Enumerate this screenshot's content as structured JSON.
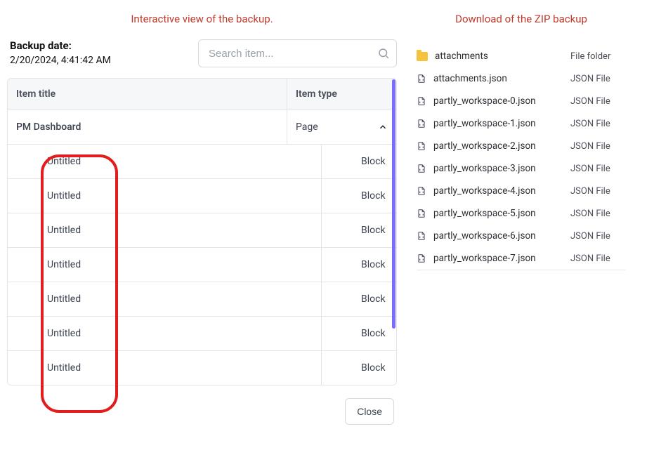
{
  "captions": {
    "left": "Interactive view of the backup.",
    "right": "Download of the ZIP backup"
  },
  "backup": {
    "label": "Backup date:",
    "value": "2/20/2024, 4:41:42 AM"
  },
  "search": {
    "placeholder": "Search item..."
  },
  "table": {
    "header_title": "Item title",
    "header_type": "Item type",
    "page": {
      "title": "PM Dashboard",
      "type": "Page"
    },
    "blocks": [
      {
        "title": "Untitled",
        "type": "Block"
      },
      {
        "title": "Untitled",
        "type": "Block"
      },
      {
        "title": "Untitled",
        "type": "Block"
      },
      {
        "title": "Untitled",
        "type": "Block"
      },
      {
        "title": "Untitled",
        "type": "Block"
      },
      {
        "title": "Untitled",
        "type": "Block"
      },
      {
        "title": "Untitled",
        "type": "Block"
      }
    ]
  },
  "close_label": "Close",
  "files": [
    {
      "name": "attachments",
      "type": "File folder",
      "icon": "folder"
    },
    {
      "name": "attachments.json",
      "type": "JSON File",
      "icon": "json"
    },
    {
      "name": "partly_workspace-0.json",
      "type": "JSON File",
      "icon": "json"
    },
    {
      "name": "partly_workspace-1.json",
      "type": "JSON File",
      "icon": "json"
    },
    {
      "name": "partly_workspace-2.json",
      "type": "JSON File",
      "icon": "json"
    },
    {
      "name": "partly_workspace-3.json",
      "type": "JSON File",
      "icon": "json"
    },
    {
      "name": "partly_workspace-4.json",
      "type": "JSON File",
      "icon": "json"
    },
    {
      "name": "partly_workspace-5.json",
      "type": "JSON File",
      "icon": "json"
    },
    {
      "name": "partly_workspace-6.json",
      "type": "JSON File",
      "icon": "json"
    },
    {
      "name": "partly_workspace-7.json",
      "type": "JSON File",
      "icon": "json"
    }
  ]
}
